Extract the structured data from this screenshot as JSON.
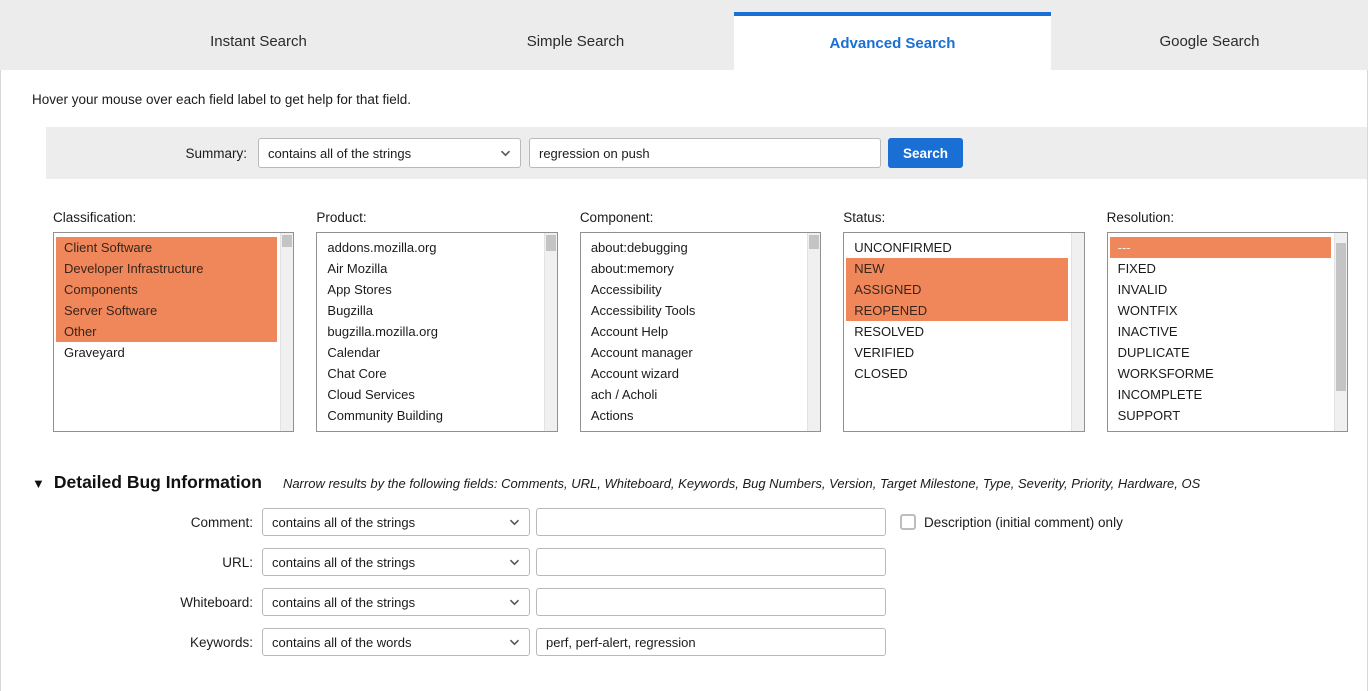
{
  "colors": {
    "accent": "#1a6fd4",
    "selection": "#f0875a",
    "tabbar_bg": "#ececec",
    "panel_bg": "#ededed"
  },
  "tabs": [
    {
      "label": "Instant Search",
      "active": false
    },
    {
      "label": "Simple Search",
      "active": false
    },
    {
      "label": "Advanced Search",
      "active": true
    },
    {
      "label": "Google Search",
      "active": false
    }
  ],
  "help_text": "Hover your mouse over each field label to get help for that field.",
  "summary": {
    "label": "Summary:",
    "match_option": "contains all of the strings",
    "value": "regression on push",
    "search_button": "Search"
  },
  "listboxes": [
    {
      "label": "Classification:",
      "items": [
        {
          "text": "Client Software",
          "selected": true
        },
        {
          "text": "Developer Infrastructure",
          "selected": true
        },
        {
          "text": "Components",
          "selected": true
        },
        {
          "text": "Server Software",
          "selected": true
        },
        {
          "text": "Other",
          "selected": true
        },
        {
          "text": "Graveyard",
          "selected": false
        }
      ]
    },
    {
      "label": "Product:",
      "items": [
        {
          "text": "addons.mozilla.org",
          "selected": false
        },
        {
          "text": "Air Mozilla",
          "selected": false
        },
        {
          "text": "App Stores",
          "selected": false
        },
        {
          "text": "Bugzilla",
          "selected": false
        },
        {
          "text": "bugzilla.mozilla.org",
          "selected": false
        },
        {
          "text": "Calendar",
          "selected": false
        },
        {
          "text": "Chat Core",
          "selected": false
        },
        {
          "text": "Cloud Services",
          "selected": false
        },
        {
          "text": "Community Building",
          "selected": false
        }
      ]
    },
    {
      "label": "Component:",
      "items": [
        {
          "text": "about:debugging",
          "selected": false
        },
        {
          "text": "about:memory",
          "selected": false
        },
        {
          "text": "Accessibility",
          "selected": false
        },
        {
          "text": "Accessibility Tools",
          "selected": false
        },
        {
          "text": "Account Help",
          "selected": false
        },
        {
          "text": "Account manager",
          "selected": false
        },
        {
          "text": "Account wizard",
          "selected": false
        },
        {
          "text": "ach / Acholi",
          "selected": false
        },
        {
          "text": "Actions",
          "selected": false
        }
      ]
    },
    {
      "label": "Status:",
      "items": [
        {
          "text": "UNCONFIRMED",
          "selected": false
        },
        {
          "text": "NEW",
          "selected": true
        },
        {
          "text": "ASSIGNED",
          "selected": true
        },
        {
          "text": "REOPENED",
          "selected": true
        },
        {
          "text": "RESOLVED",
          "selected": false
        },
        {
          "text": "VERIFIED",
          "selected": false
        },
        {
          "text": "CLOSED",
          "selected": false
        }
      ]
    },
    {
      "label": "Resolution:",
      "items": [
        {
          "text": "---",
          "selected": true,
          "muted": true
        },
        {
          "text": "FIXED",
          "selected": false
        },
        {
          "text": "INVALID",
          "selected": false
        },
        {
          "text": "WONTFIX",
          "selected": false
        },
        {
          "text": "INACTIVE",
          "selected": false
        },
        {
          "text": "DUPLICATE",
          "selected": false
        },
        {
          "text": "WORKSFORME",
          "selected": false
        },
        {
          "text": "INCOMPLETE",
          "selected": false
        },
        {
          "text": "SUPPORT",
          "selected": false
        }
      ]
    }
  ],
  "detailed_section": {
    "collapse_arrow": "▼",
    "title": "Detailed Bug Information",
    "note": "Narrow results by the following fields: Comments, URL, Whiteboard, Keywords, Bug Numbers, Version, Target Milestone, Type, Severity, Priority, Hardware, OS",
    "rows": [
      {
        "id": "comment",
        "label": "Comment:",
        "match_option": "contains all of the strings",
        "value": "",
        "checkbox_label": "Description (initial comment) only",
        "checkbox_checked": false
      },
      {
        "id": "url",
        "label": "URL:",
        "match_option": "contains all of the strings",
        "value": ""
      },
      {
        "id": "whiteboard",
        "label": "Whiteboard:",
        "match_option": "contains all of the strings",
        "value": ""
      },
      {
        "id": "keywords",
        "label": "Keywords:",
        "match_option": "contains all of the words",
        "value": "perf, perf-alert, regression"
      }
    ]
  }
}
